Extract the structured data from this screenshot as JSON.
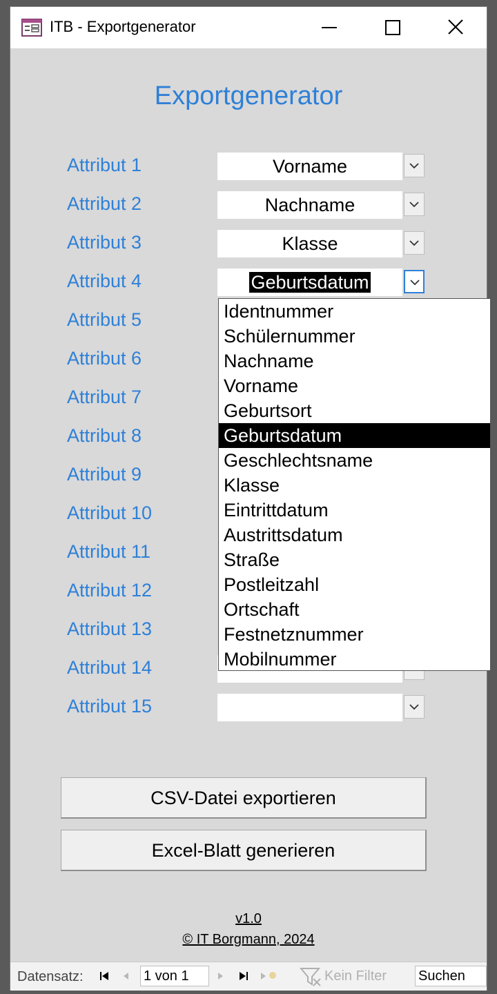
{
  "window": {
    "title": "ITB - Exportgenerator"
  },
  "form": {
    "heading": "Exportgenerator",
    "attributes": [
      {
        "label": "Attribut 1",
        "value": "Vorname"
      },
      {
        "label": "Attribut 2",
        "value": "Nachname"
      },
      {
        "label": "Attribut 3",
        "value": "Klasse"
      },
      {
        "label": "Attribut 4",
        "value": "Geburtsdatum"
      },
      {
        "label": "Attribut 5",
        "value": ""
      },
      {
        "label": "Attribut 6",
        "value": ""
      },
      {
        "label": "Attribut 7",
        "value": ""
      },
      {
        "label": "Attribut 8",
        "value": ""
      },
      {
        "label": "Attribut 9",
        "value": ""
      },
      {
        "label": "Attribut 10",
        "value": ""
      },
      {
        "label": "Attribut 11",
        "value": ""
      },
      {
        "label": "Attribut 12",
        "value": ""
      },
      {
        "label": "Attribut 13",
        "value": ""
      },
      {
        "label": "Attribut 14",
        "value": ""
      },
      {
        "label": "Attribut 15",
        "value": ""
      }
    ],
    "dropdown": {
      "open_for": "Attribut 4",
      "selected": "Geburtsdatum",
      "options": [
        "Identnummer",
        "Schülernummer",
        "Nachname",
        "Vorname",
        "Geburtsort",
        "Geburtsdatum",
        "Geschlechtsname",
        "Klasse",
        "Eintrittdatum",
        "Austrittsdatum",
        "Straße",
        "Postleitzahl",
        "Ortschaft",
        "Festnetznummer",
        "Mobilnummer"
      ]
    },
    "buttons": {
      "export_csv": "CSV-Datei exportieren",
      "generate_excel": "Excel-Blatt generieren"
    },
    "footer": {
      "version": "v1.0",
      "copyright": "© IT Borgmann, 2024"
    }
  },
  "navbar": {
    "label": "Datensatz:",
    "record": "1 von 1",
    "filter": "Kein Filter",
    "search": "Suchen"
  },
  "colors": {
    "accent": "#2e80d8",
    "background": "#d9d9d9"
  },
  "icons": [
    "form-icon",
    "minimize-icon",
    "maximize-icon",
    "close-icon",
    "chevron-down-icon",
    "first-record-icon",
    "previous-record-icon",
    "next-record-icon",
    "last-record-icon",
    "new-record-icon",
    "filter-icon"
  ]
}
